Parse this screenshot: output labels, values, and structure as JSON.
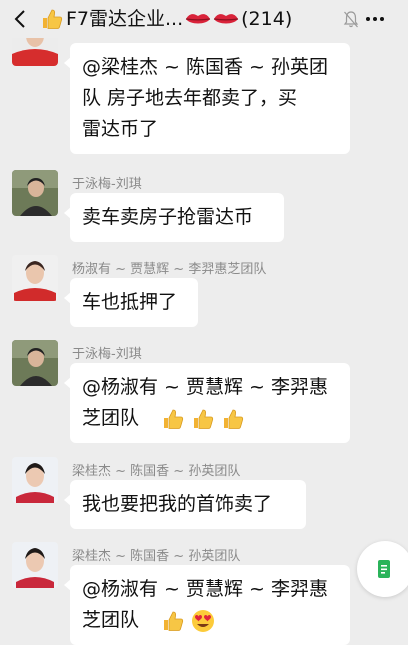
{
  "header": {
    "title": "F7雷达企业...",
    "member_count": "(214)"
  },
  "messages": [
    {
      "sender": "",
      "avatar": "woman-red-top",
      "lines": [
        "@梁桂杰 ~ 陈国香 ~ 孙英团",
        "队  房子地去年都卖了，买",
        "雷达币了"
      ]
    },
    {
      "sender": "于泳梅-刘琪",
      "avatar": "woman-outdoor",
      "lines": [
        "卖车卖房子抢雷达币"
      ]
    },
    {
      "sender": "杨淑有 ~ 贾慧辉 ~ 李羿惠芝团队",
      "avatar": "woman-red-top",
      "lines": [
        "车也抵押了"
      ]
    },
    {
      "sender": "于泳梅-刘琪",
      "avatar": "woman-outdoor",
      "lines": [
        "@杨淑有 ~ 贾慧辉 ~ 李羿惠",
        "芝团队"
      ]
    },
    {
      "sender": "梁桂杰 ~ 陈国香 ~ 孙英团队",
      "avatar": "woman-portrait",
      "lines": [
        "我也要把我的首饰卖了"
      ]
    },
    {
      "sender": "梁桂杰 ~ 陈国香 ~ 孙英团队",
      "avatar": "woman-portrait",
      "lines": [
        "@杨淑有 ~ 贾慧辉 ~ 李羿惠",
        "芝团队"
      ]
    }
  ]
}
